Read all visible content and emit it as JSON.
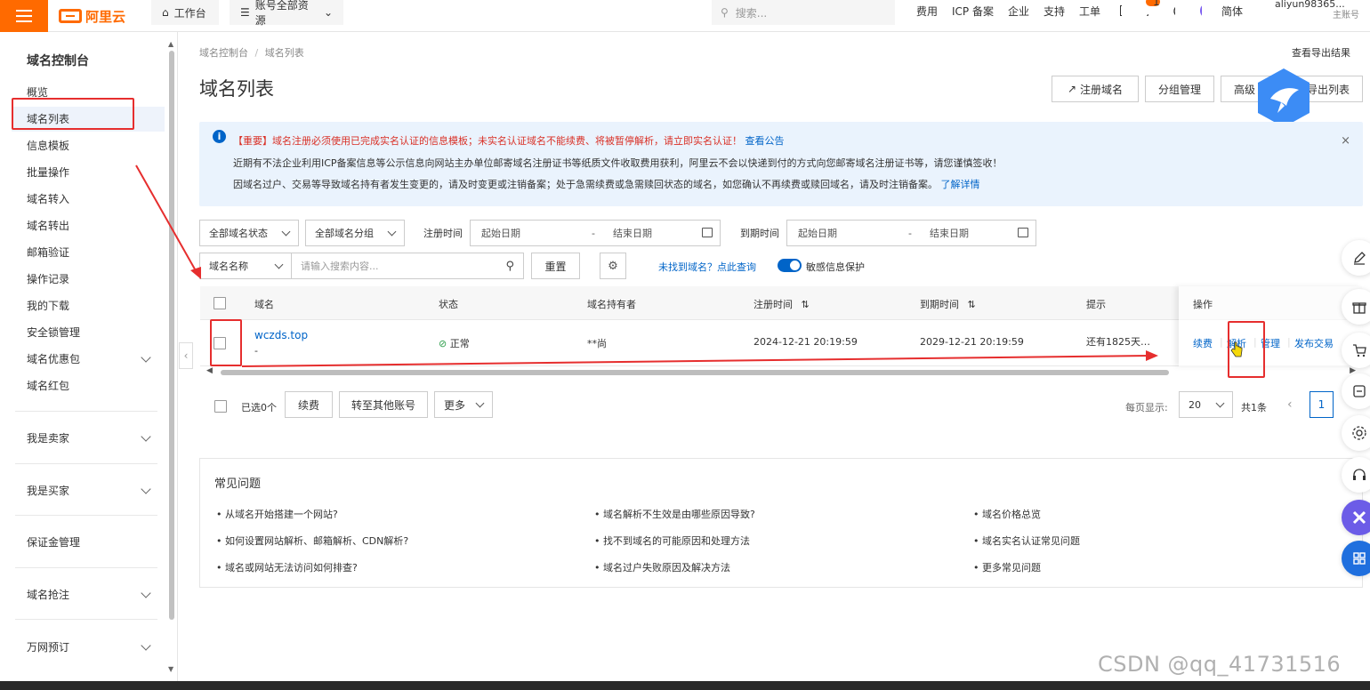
{
  "topbar": {
    "logo": "阿里云",
    "home": "工作台",
    "account_menu": "账号全部资源",
    "search_placeholder": "搜索...",
    "links": [
      "费用",
      "ICP 备案",
      "企业",
      "支持",
      "工单"
    ],
    "notification_count": "1",
    "lang": "简体",
    "user_name": "aliyun98365...",
    "user_role": "主账号"
  },
  "sidebar": {
    "title": "域名控制台",
    "items": [
      {
        "label": "概览"
      },
      {
        "label": "域名列表"
      },
      {
        "label": "信息模板"
      },
      {
        "label": "批量操作"
      },
      {
        "label": "域名转入"
      },
      {
        "label": "域名转出"
      },
      {
        "label": "邮箱验证"
      },
      {
        "label": "操作记录"
      },
      {
        "label": "我的下载"
      },
      {
        "label": "安全锁管理"
      },
      {
        "label": "域名优惠包"
      },
      {
        "label": "域名红包"
      }
    ],
    "groups": [
      "我是卖家",
      "我是买家",
      "保证金管理",
      "域名抢注",
      "万网预订"
    ]
  },
  "page": {
    "breadcrumb_root": "域名控制台",
    "breadcrumb_sep": "/",
    "breadcrumb_current": "域名列表",
    "title": "域名列表",
    "export_result": "查看导出结果",
    "btn_register": "注册域名",
    "btn_group": "分组管理",
    "btn_advanced": "高级",
    "btn_export": "导出列表"
  },
  "notice": {
    "line1_red": "【重要】域名注册必须使用已完成实名认证的信息模板；未实名认证域名不能续费、将被暂停解析，请立即实名认证！",
    "line1_link": "查看公告",
    "line2": "近期有不法企业利用ICP备案信息等公示信息向网站主办单位邮寄域名注册证书等纸质文件收取费用获利，阿里云不会以快递到付的方式向您邮寄域名注册证书等，请您谨慎签收！",
    "line3": "因域名过户、交易等导致域名持有者发生变更的，请及时变更或注销备案；处于急需续费或急需赎回状态的域名，如您确认不再续费或赎回域名，请及时注销备案。",
    "line3_link": "了解详情",
    "close": "×"
  },
  "filters": {
    "status": "全部域名状态",
    "group": "全部域名分组",
    "reg_time_label": "注册时间",
    "exp_time_label": "到期时间",
    "start_date": "起始日期",
    "date_sep": "-",
    "end_date": "结束日期",
    "search_field": "域名名称",
    "search_placeholder": "请输入搜索内容...",
    "reset": "重置",
    "not_found": "未找到域名？点此查询",
    "privacy_toggle": "敏感信息保护"
  },
  "table": {
    "headers": {
      "domain": "域名",
      "status": "状态",
      "holder": "域名持有者",
      "reg_time": "注册时间",
      "exp_time": "到期时间",
      "tip": "提示",
      "ops": "操作"
    },
    "rows": [
      {
        "domain": "wczds.top",
        "sub": "-",
        "status": "正常",
        "holder": "**尚",
        "reg_time": "2024-12-21 20:19:59",
        "exp_time": "2029-12-21 20:19:59",
        "tip": "还有1825天…",
        "ops": [
          "续费",
          "解析",
          "管理",
          "发布交易"
        ]
      }
    ]
  },
  "bulk": {
    "selected": "已选0个",
    "renew": "续费",
    "transfer": "转至其他账号",
    "more": "更多"
  },
  "pager": {
    "per_page_label": "每页显示:",
    "per_page": "20",
    "total": "共1条",
    "current": "1"
  },
  "faq": {
    "title": "常见问题",
    "items": [
      "从域名开始搭建一个网站?",
      "域名解析不生效是由哪些原因导致?",
      "域名价格总览",
      "如何设置网站解析、邮箱解析、CDN解析?",
      "找不到域名的可能原因和处理方法",
      "域名实名认证常见问题",
      "域名或网站无法访问如何排查?",
      "域名过户失败原因及解决方法",
      "更多常见问题"
    ]
  },
  "watermark": "CSDN @qq_41731516",
  "colors": {
    "brand": "#ff6a00",
    "link": "#0064c8",
    "annotation": "#e62e2e"
  }
}
